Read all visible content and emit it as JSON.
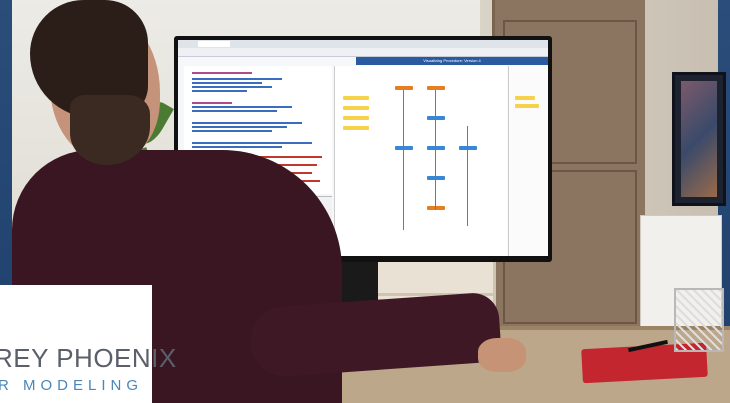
{
  "scene": {
    "description_tag": "photo-of-developer-at-monitor",
    "monitor": {
      "app_title": "Visualizing Procedure: Version 4"
    }
  },
  "logo": {
    "line1": "REY PHOENIX",
    "line2": "R MODELING",
    "colors": {
      "line1": "#5b5f6a",
      "line2": "#4a86b9"
    }
  },
  "colors": {
    "frame": "#1f3f6b",
    "sweater": "#3a1622",
    "notebook": "#c4262f",
    "screen_accent": "#2a5aa0"
  }
}
